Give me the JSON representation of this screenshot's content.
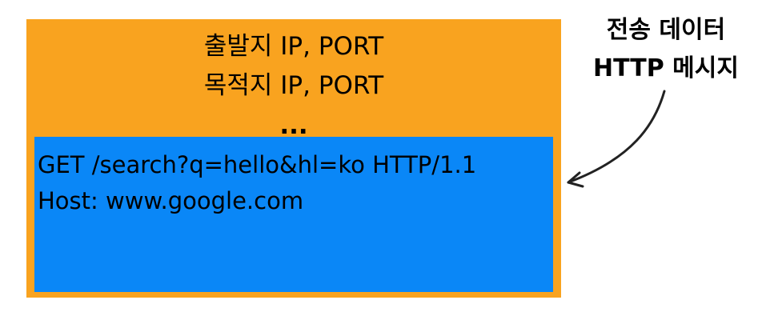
{
  "colors": {
    "packet_bg": "#F9A31F",
    "message_bg": "#0A87F7",
    "arrow": "#222222",
    "text": "#000000"
  },
  "packet_header": {
    "source_line": "출발지 IP, PORT",
    "destination_line": "목적지 IP, PORT",
    "ellipsis": "..."
  },
  "http_message": {
    "request_line": "GET /search?q=hello&hl=ko HTTP/1.1",
    "host_line": "Host: www.google.com"
  },
  "callout": {
    "line_1": "전송 데이터",
    "line_2": "HTTP 메시지",
    "icon": "curved-arrow-icon"
  }
}
